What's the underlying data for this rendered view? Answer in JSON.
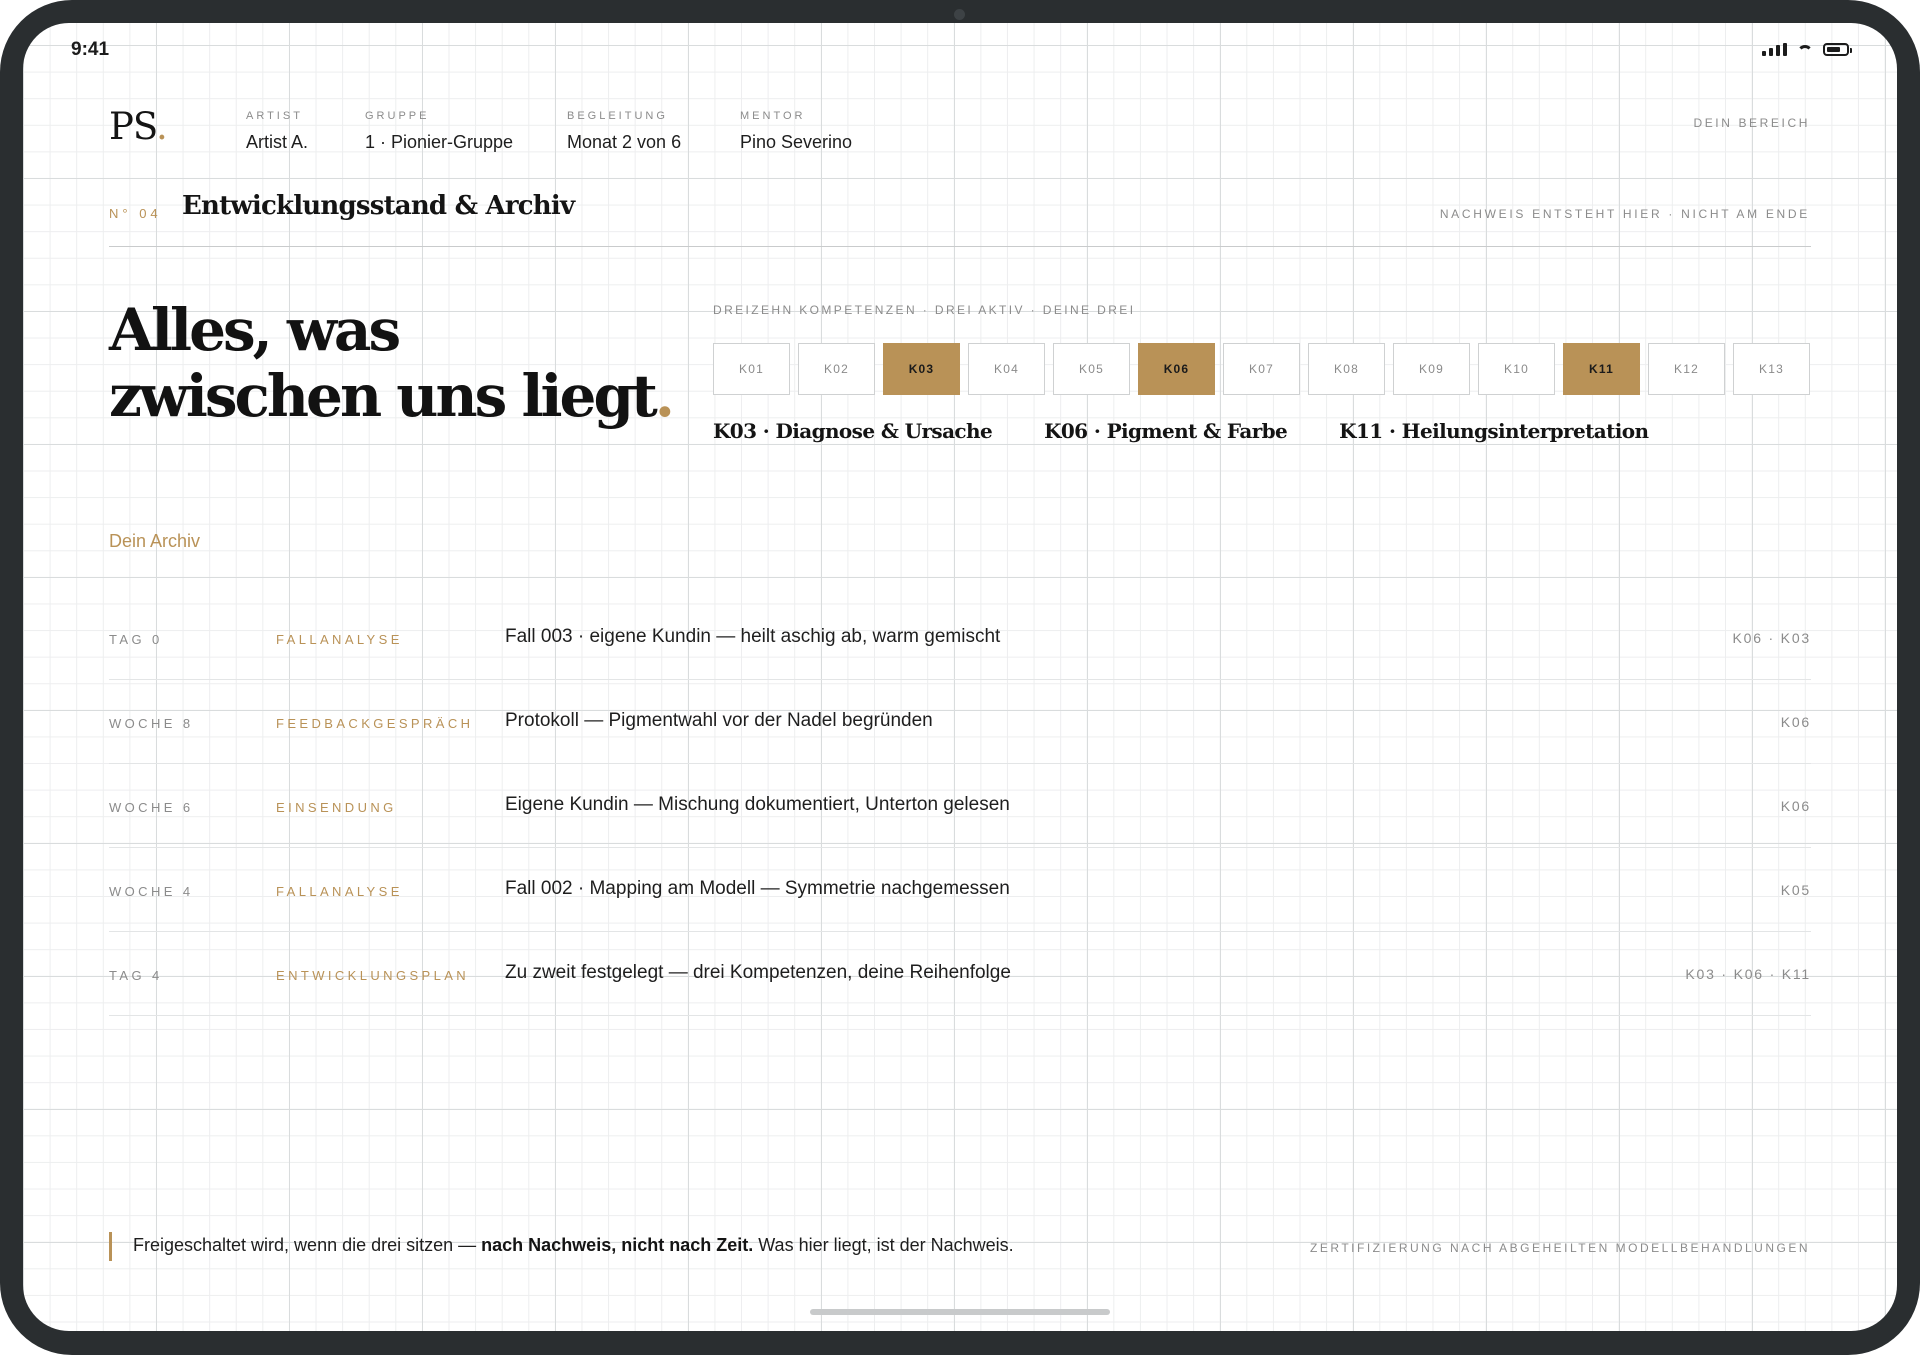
{
  "status_bar": {
    "time": "9:41"
  },
  "header": {
    "logo_text": "PS",
    "logo_dot": ".",
    "meta": [
      {
        "label": "ARTIST",
        "value": "Artist A."
      },
      {
        "label": "GRUPPE",
        "value": "1 · Pionier-Gruppe"
      },
      {
        "label": "BEGLEITUNG",
        "value": "Monat 2 von 6"
      },
      {
        "label": "MENTOR",
        "value": "Pino Severino"
      }
    ],
    "region_label": "DEIN BEREICH"
  },
  "section": {
    "number": "N° 04",
    "title": "Entwicklungsstand & Archiv",
    "note": "NACHWEIS ENTSTEHT HIER · NICHT AM ENDE"
  },
  "hero": {
    "line1": "Alles, was",
    "line2": "zwischen uns liegt",
    "dot": "."
  },
  "kompetenzen": {
    "label": "DREIZEHN KOMPETENZEN · DREI AKTIV · DEINE DREI",
    "items": [
      "K01",
      "K02",
      "K03",
      "K04",
      "K05",
      "K06",
      "K07",
      "K08",
      "K09",
      "K10",
      "K11",
      "K12",
      "K13"
    ],
    "active": [
      "K03",
      "K06",
      "K11"
    ],
    "active_names": [
      "K03 · Diagnose & Ursache",
      "K06 · Pigment & Farbe",
      "K11 · Heilungsinterpretation"
    ]
  },
  "archive": {
    "heading": "Dein Archiv",
    "rows": [
      {
        "when": "TAG 0",
        "kind": "FALLANALYSE",
        "desc": "Fall 003 · eigene Kundin — heilt aschig ab, warm gemischt",
        "refs": "K06 · K03"
      },
      {
        "when": "WOCHE 8",
        "kind": "FEEDBACKGESPRÄCH",
        "desc": "Protokoll — Pigmentwahl vor der Nadel begründen",
        "refs": "K06"
      },
      {
        "when": "WOCHE 6",
        "kind": "EINSENDUNG",
        "desc": "Eigene Kundin — Mischung dokumentiert, Unterton gelesen",
        "refs": "K06"
      },
      {
        "when": "WOCHE 4",
        "kind": "FALLANALYSE",
        "desc": "Fall 002 · Mapping am Modell — Symmetrie nachgemessen",
        "refs": "K05"
      },
      {
        "when": "TAG 4",
        "kind": "ENTWICKLUNGSPLAN",
        "desc": "Zu zweit festgelegt — drei Kompetenzen, deine Reihenfolge",
        "refs": "K03 · K06 · K11"
      }
    ]
  },
  "footer": {
    "text_before": "Freigeschaltet wird, wenn die drei sitzen — ",
    "text_bold": "nach Nachweis, nicht nach Zeit.",
    "text_after": " Was hier liegt, ist der Nachweis.",
    "right": "ZERTIFIZIERUNG NACH ABGEHEILTEN MODELLBEHANDLUNGEN"
  },
  "colors": {
    "accent": "#b99257",
    "ink": "#141414",
    "muted": "#8b8b8b",
    "frame": "#2a2e30"
  }
}
